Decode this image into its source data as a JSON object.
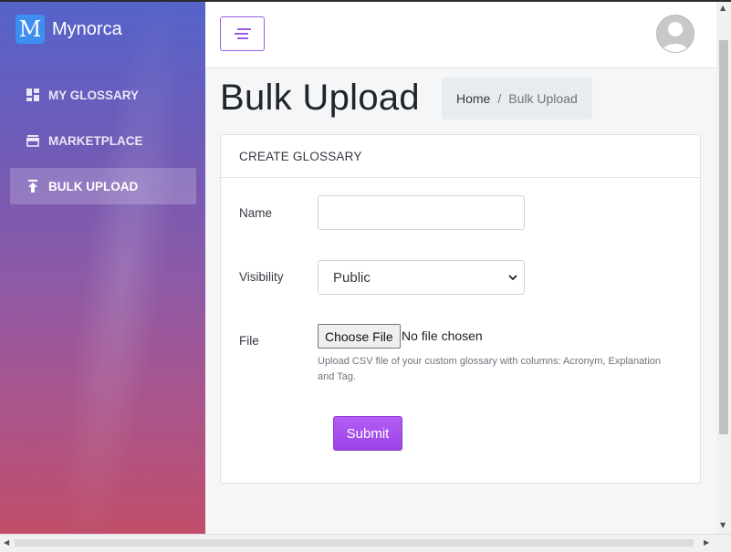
{
  "brand": {
    "logo_letter": "M",
    "name": "Mynorca",
    "logo_color": "#3d8ef0"
  },
  "sidebar": {
    "items": [
      {
        "label": "MY GLOSSARY",
        "icon": "dashboard-icon",
        "active": false
      },
      {
        "label": "MARKETPLACE",
        "icon": "store-icon",
        "active": false
      },
      {
        "label": "BULK UPLOAD",
        "icon": "upload-icon",
        "active": true
      }
    ]
  },
  "topbar": {
    "menu_icon": "menu-icon",
    "avatar_icon": "user-avatar-icon",
    "accent": "#9b5de5"
  },
  "page": {
    "title": "Bulk Upload"
  },
  "breadcrumb": {
    "home": "Home",
    "separator": "/",
    "current": "Bulk Upload"
  },
  "card": {
    "header": "CREATE GLOSSARY",
    "fields": {
      "name": {
        "label": "Name",
        "value": "",
        "placeholder": ""
      },
      "visibility": {
        "label": "Visibility",
        "selected": "Public"
      },
      "file": {
        "label": "File",
        "button": "Choose File",
        "status": "No file chosen",
        "help": "Upload CSV file of your custom glossary with columns: Acronym, Explanation and Tag."
      }
    },
    "submit": "Submit"
  }
}
